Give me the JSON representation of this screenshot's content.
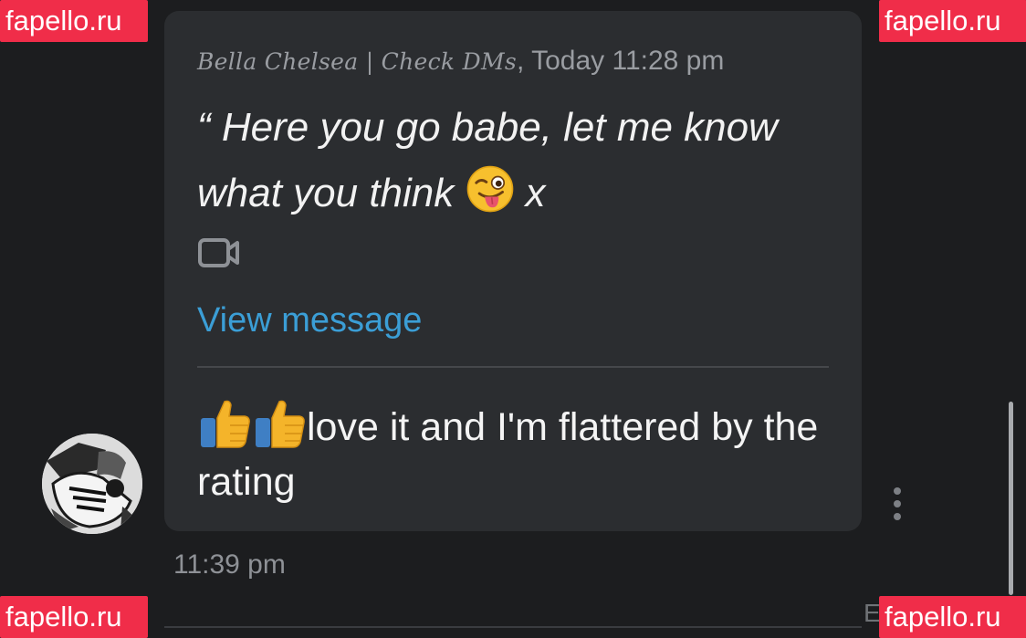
{
  "message": {
    "quote_author": "Bella Chelsea | Check DMs",
    "quote_timestamp": ", Today 11:28 pm",
    "quote_open": "“ Here you go babe, let me know what you think",
    "quote_close": "x",
    "attachment_icon": "video-camera-icon",
    "view_link": "View message",
    "reply_text": "love it and I'm flattered by the rating",
    "reply_emojis": [
      "thumbs-up",
      "thumbs-up"
    ],
    "time": "11:39 pm"
  },
  "footer": {
    "partial_text": "E"
  },
  "watermarks": {
    "top_left": "fapello.ru",
    "top_right": "fapello.ru",
    "bottom_left": "fapello.ru",
    "bottom_right": "fapello.ru"
  },
  "colors": {
    "background": "#1c1d1f",
    "bubble": "#2b2d30",
    "link": "#3b9ed6",
    "watermark": "#f02d49"
  }
}
